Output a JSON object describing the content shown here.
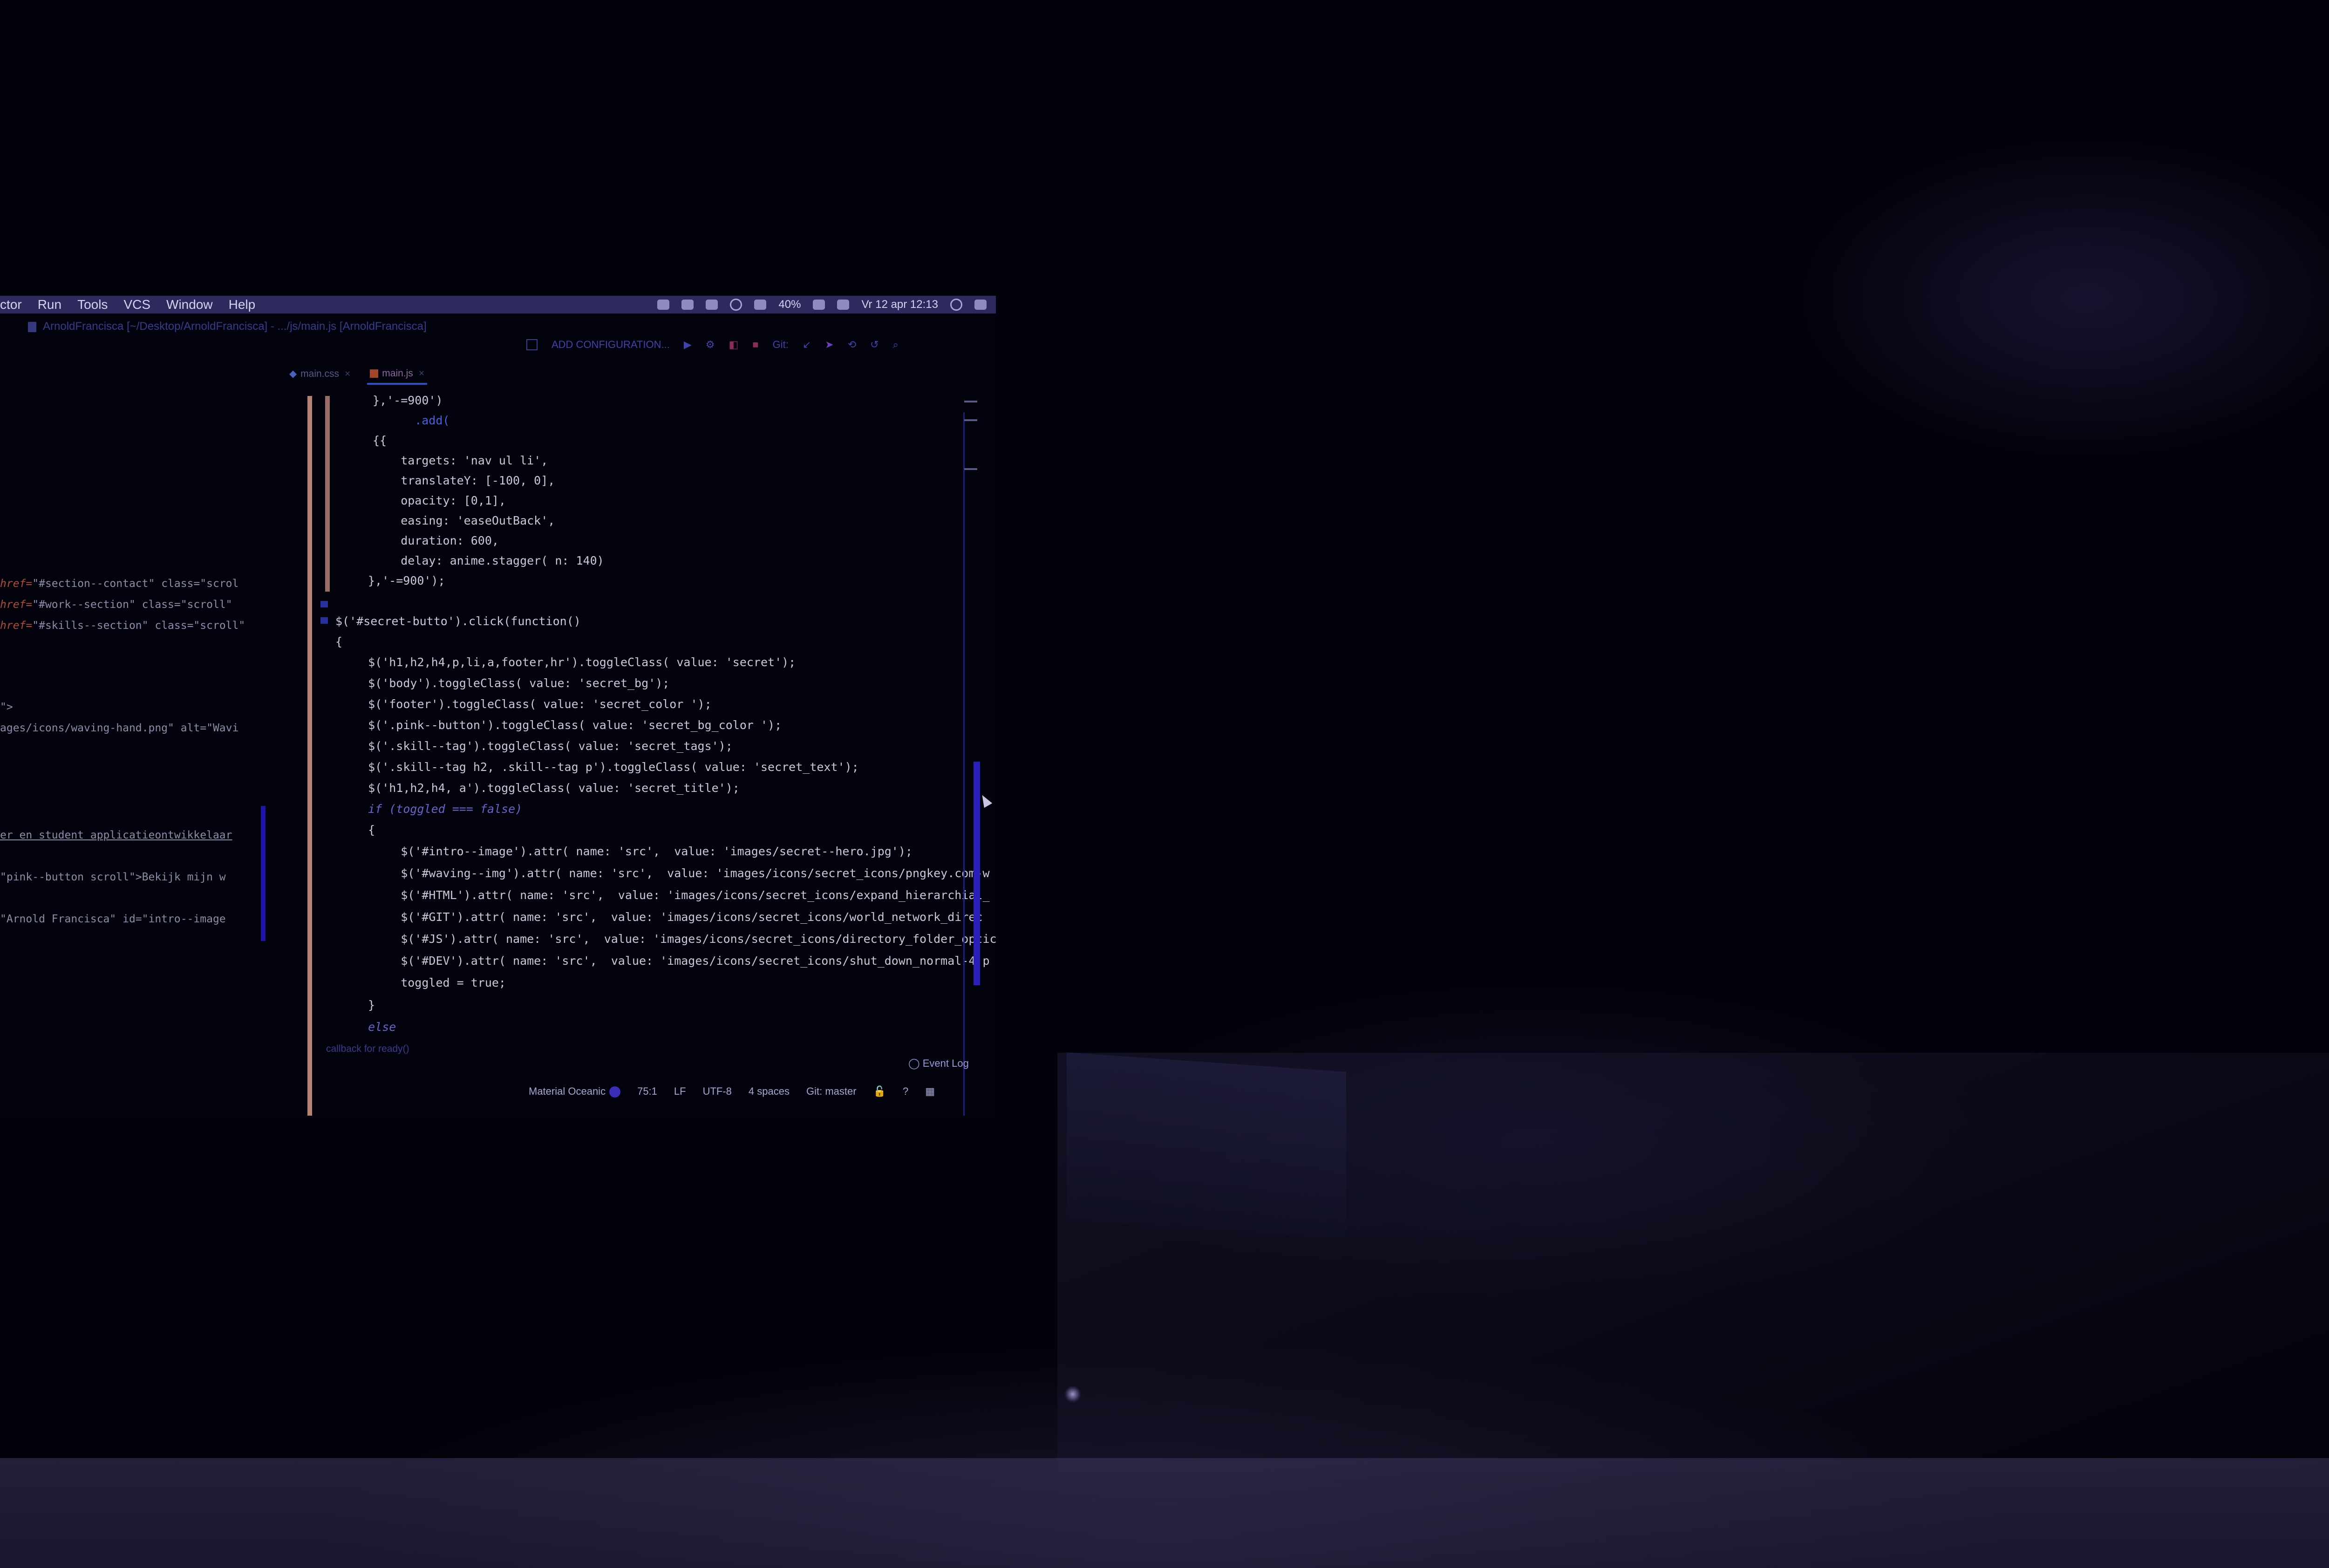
{
  "menubar": {
    "items": [
      "ctor",
      "Run",
      "Tools",
      "VCS",
      "Window",
      "Help"
    ],
    "battery": "40%",
    "datetime": "Vr 12 apr  12:13"
  },
  "breadcrumb": "ArnoldFrancisca [~/Desktop/ArnoldFrancisca] - .../js/main.js [ArnoldFrancisca]",
  "toolbar": {
    "config_label": "ADD CONFIGURATION...",
    "git_label": "Git:"
  },
  "tabs": [
    {
      "label": "main.css"
    },
    {
      "label": "main.js"
    }
  ],
  "left_pane": {
    "lines": [
      {
        "pre": "href=",
        "rest": "\"#section--contact\" class=\"scrol"
      },
      {
        "pre": "href=",
        "rest": "\"#work--section\" class=\"scroll\""
      },
      {
        "pre": "href=",
        "rest": "\"#skills--section\" class=\"scroll\""
      },
      {
        "pre": "",
        "rest": "\">"
      },
      {
        "pre": "",
        "rest": "ages/icons/waving-hand.png\" alt=\"Wavi"
      },
      {
        "pre": "",
        "rest": "er en student applicatieontwikkelaar"
      },
      {
        "pre": "",
        "rest": "\"pink--button scroll\">Bekijk mijn w"
      },
      {
        "pre": "",
        "rest": "\"Arnold Francisca\" id=\"intro--image"
      }
    ]
  },
  "code": {
    "lines": [
      "},'-=900')",
      "    .add(",
      "{{",
      "    targets: 'nav ul li',",
      "    translateY: [-100, 0],",
      "    opacity: [0,1],",
      "    easing: 'easeOutBack',",
      "    duration: 600,",
      "    delay: anime.stagger( n: 140)",
      "},'-=900');",
      "$('#secret-butto').click(function()",
      "{",
      "  $('h1,h2,h4,p,li,a,footer,hr').toggleClass( value: 'secret');",
      "  $('body').toggleClass( value: 'secret_bg');",
      "  $('footer').toggleClass( value: 'secret_color ');",
      "  $('.pink--button').toggleClass( value: 'secret_bg_color ');",
      "  $('.skill--tag').toggleClass( value: 'secret_tags');",
      "  $('.skill--tag h2, .skill--tag p').toggleClass( value: 'secret_text');",
      "  $('h1,h2,h4, a').toggleClass( value: 'secret_title');",
      "  if (toggled === false)",
      "  {",
      "    $('#intro--image').attr( name: 'src',  value: 'images/secret--hero.jpg');",
      "    $('#waving--img').attr( name: 'src',  value: 'images/icons/secret_icons/pngkey.com-w",
      "    $('#HTML').attr( name: 'src',  value: 'images/icons/secret_icons/expand_hierarchial_",
      "    $('#GIT').attr( name: 'src',  value: 'images/icons/secret_icons/world_network_direc",
      "    $('#JS').attr( name: 'src',  value: 'images/icons/secret_icons/directory_folder_optic",
      "    $('#DEV').attr( name: 'src',  value: 'images/icons/secret_icons/shut_down_normal-4.p",
      "    toggled = true;",
      "  }",
      "  else"
    ]
  },
  "callback_hint": "callback for ready()",
  "event_log": "Event Log",
  "statusbar": {
    "theme": "Material Oceanic",
    "position": "75:1",
    "line_sep": "LF",
    "encoding": "UTF-8",
    "indent": "4 spaces",
    "git_branch": "Git: master",
    "help": "?"
  },
  "colors": {
    "menubar_bg": "#2f2a5e",
    "accent": "#2f4fc8",
    "gutter": "#b58273"
  }
}
